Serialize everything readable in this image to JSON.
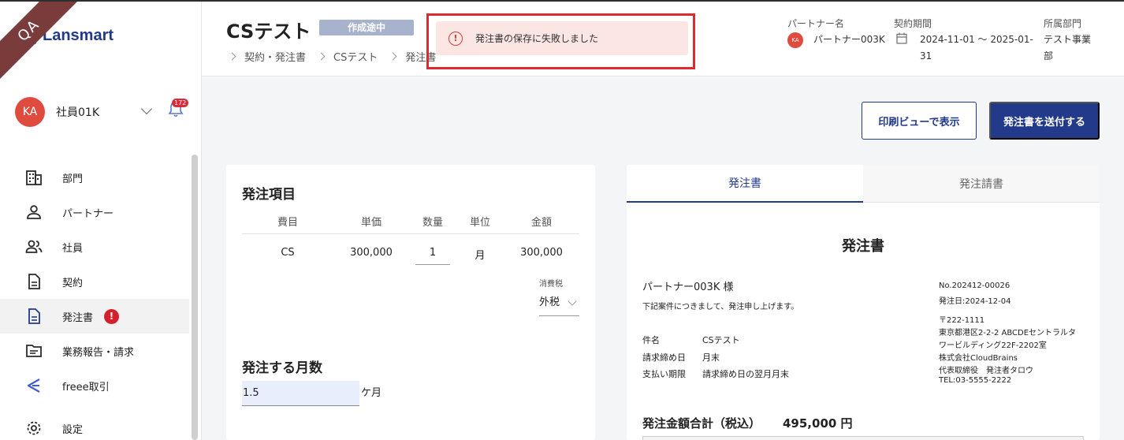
{
  "brand": {
    "ribbon": "QA",
    "logo_text": "Lansmart",
    "accent": "#233a8a"
  },
  "user": {
    "initials": "KA",
    "name": "社員01K",
    "notification_count": "172"
  },
  "sidebar": {
    "items": [
      {
        "label": "部門",
        "icon": "building-icon"
      },
      {
        "label": "パートナー",
        "icon": "person-icon"
      },
      {
        "label": "社員",
        "icon": "people-icon"
      },
      {
        "label": "契約",
        "icon": "document-icon"
      },
      {
        "label": "発注書",
        "icon": "document-icon",
        "active": true,
        "alert": "!"
      },
      {
        "label": "業務報告・請求",
        "icon": "folder-icon"
      },
      {
        "label": "freee取引",
        "icon": "freee-icon"
      },
      {
        "label": "設定",
        "icon": "gear-icon"
      }
    ]
  },
  "header": {
    "title": "CSテスト",
    "status": "作成途中",
    "breadcrumb": [
      "契約・発注書",
      "CSテスト",
      "発注書"
    ],
    "partner_label": "パートナー名",
    "partner_initials": "KA",
    "partner_name": "パートナー003K",
    "period_label": "契約期間",
    "period_line1": "2024-11-01 〜 2025-01-",
    "period_line2": "31",
    "dept_label": "所属部門",
    "dept_line1": "テスト事業",
    "dept_line2": "部"
  },
  "toast": {
    "message": "発注書の保存に失敗しました",
    "color": "#e0282f"
  },
  "actions": {
    "print_view": "印刷ビューで表示",
    "send": "発注書を送付する"
  },
  "order_items": {
    "title": "発注項目",
    "columns": [
      "費目",
      "単価",
      "数量",
      "単位",
      "金額"
    ],
    "rows": [
      {
        "item": "CS",
        "unit_price": "300,000",
        "quantity": "1",
        "unit": "月",
        "amount": "300,000"
      }
    ],
    "tax_label": "消費税",
    "tax_value": "外税"
  },
  "months": {
    "title": "発注する月数",
    "value": "1.5",
    "unit": "ケ月"
  },
  "preview": {
    "tabs": [
      "発注書",
      "発注請書"
    ],
    "doc_title": "発注書",
    "recipient": "パートナー003K 様",
    "intro": "下記案件につきまして、発注申し上げます。",
    "fields": [
      {
        "label": "件名",
        "value": "CSテスト"
      },
      {
        "label": "請求締め日",
        "value": "月末"
      },
      {
        "label": "支払い期限",
        "value": "請求締め日の翌月月末"
      }
    ],
    "doc_no": "No.202412-00026",
    "issue_date": "発注日:2024-12-04",
    "postal": "〒222-1111",
    "address1": "東京都港区2-2-2 ABCDEセントラルタ",
    "address2": "ワービルディング22F-2202室",
    "company": "株式会社CloudBrains",
    "representative": "代表取締役　発注者タロウ",
    "tel": "TEL:03-5555-2222",
    "total_label": "発注金額合計（税込）",
    "total_value": "495,000 円"
  }
}
